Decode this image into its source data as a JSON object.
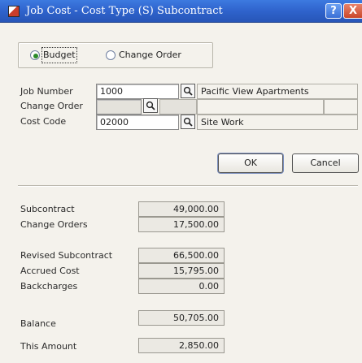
{
  "window": {
    "title": "Job Cost - Cost Type (S) Subcontract",
    "help_label": "?",
    "close_label": "X"
  },
  "radio": {
    "budget_label": "Budget",
    "change_order_label": "Change Order",
    "selected": "Budget"
  },
  "form": {
    "job_number_label": "Job Number",
    "job_number_value": "1000",
    "job_name": "Pacific View Apartments",
    "change_order_label": "Change Order",
    "change_order_value": "",
    "cost_code_label": "Cost Code",
    "cost_code_value": "02000",
    "cost_code_name": "Site Work"
  },
  "buttons": {
    "ok_label": "OK",
    "cancel_label": "Cancel"
  },
  "summary": {
    "subcontract_label": "Subcontract",
    "subcontract_value": "49,000.00",
    "change_orders_label": "Change Orders",
    "change_orders_value": "17,500.00",
    "revised_label": "Revised Subcontract",
    "revised_value": "66,500.00",
    "accrued_label": "Accrued Cost",
    "accrued_value": "15,795.00",
    "backcharges_label": "Backcharges",
    "backcharges_value": "0.00",
    "balance_label": "Balance",
    "balance_value": "50,705.00",
    "this_amount_label": "This Amount",
    "this_amount_value": "2,850.00"
  },
  "colors": {
    "titlebar": "#2f63cc",
    "dialog_bg": "#f4f2ec",
    "close_button": "#c9472a"
  },
  "icons": {
    "app": "app-icon",
    "lookup": "magnifier-icon"
  }
}
